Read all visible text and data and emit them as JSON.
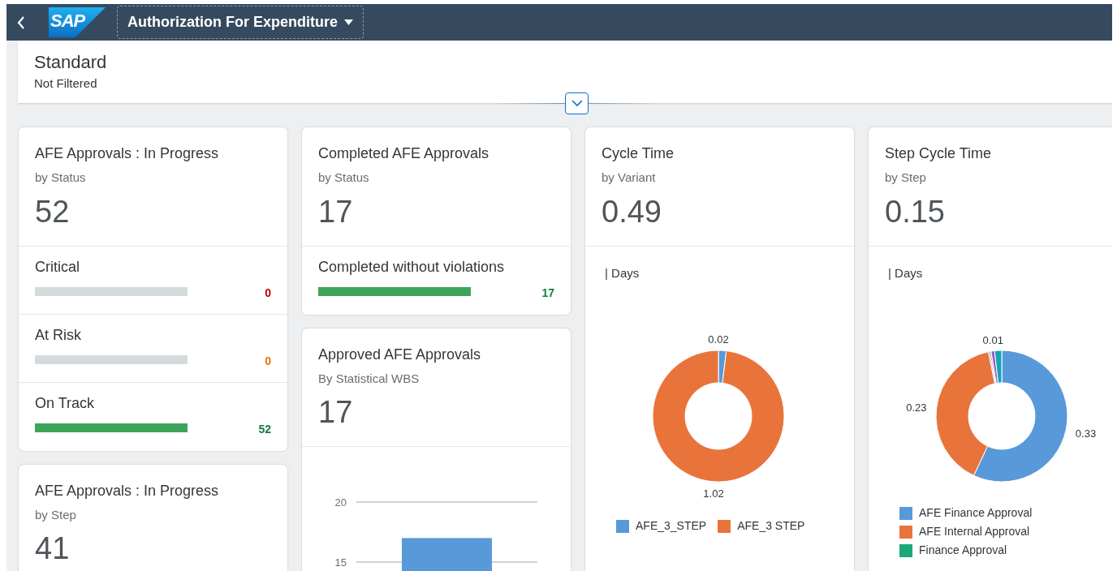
{
  "shell": {
    "logo_text": "SAP",
    "app_title": "Authorization For Expenditure"
  },
  "filter_bar": {
    "variant": "Standard",
    "status": "Not Filtered"
  },
  "columns": [
    {
      "cards": [
        {
          "kind": "status",
          "title": "AFE Approvals : In Progress",
          "subtitle": "by Status",
          "kpi": "52",
          "rows": [
            {
              "label": "Critical",
              "value": "0",
              "color": "#bb0000",
              "level": 0
            },
            {
              "label": "At Risk",
              "value": "0",
              "color": "#e9730c",
              "level": 0
            },
            {
              "label": "On Track",
              "value": "52",
              "color": "#107e3e",
              "level": 1
            }
          ]
        },
        {
          "kind": "header",
          "title": "AFE Approvals : In Progress",
          "subtitle": "by Step",
          "kpi": "41"
        }
      ]
    },
    {
      "cards": [
        {
          "kind": "status",
          "title": "Completed AFE Approvals",
          "subtitle": "by Status",
          "kpi": "17",
          "rows": [
            {
              "label": "Completed without violations",
              "value": "17",
              "color": "#107e3e",
              "level": 1
            }
          ]
        },
        {
          "kind": "bar",
          "title": "Approved AFE Approvals",
          "subtitle": "By Statistical WBS",
          "kpi": "17",
          "chart_data": {
            "type": "bar",
            "values": [
              17
            ],
            "yticks": [
              15,
              20
            ],
            "ylim": [
              0,
              20
            ]
          }
        }
      ]
    },
    {
      "cards": [
        {
          "kind": "donut",
          "title": "Cycle Time",
          "subtitle": "by Variant",
          "kpi": "0.49",
          "unit_label": "| Days",
          "chart_data": {
            "type": "donut",
            "categories": [
              "AFE_3_STEP",
              "AFE_3 STEP"
            ],
            "values": [
              0.02,
              1.02
            ],
            "colors": [
              "#5899da",
              "#e8743b"
            ],
            "value_labels": [
              "0.02",
              "1.02"
            ],
            "legend": "bottom"
          }
        }
      ]
    },
    {
      "cards": [
        {
          "kind": "donut",
          "title": "Step Cycle Time",
          "subtitle": "by Step",
          "kpi": "0.15",
          "unit_label": "| Days",
          "chart_data": {
            "type": "donut",
            "categories": [
              "AFE Finance Approval",
              "AFE Internal Approval",
              "Finance Approval",
              null,
              null,
              null
            ],
            "values": [
              0.33,
              0.23,
              0.002,
              0.002,
              0.005,
              0.01
            ],
            "colors": [
              "#5899da",
              "#e8743b",
              "#19a979",
              "#ed4a7b",
              "#945ecf",
              "#13a4b4"
            ],
            "value_labels": [
              "0.33",
              "0.23",
              null,
              null,
              null,
              "0.01"
            ],
            "legend": "bottom"
          }
        }
      ]
    }
  ]
}
